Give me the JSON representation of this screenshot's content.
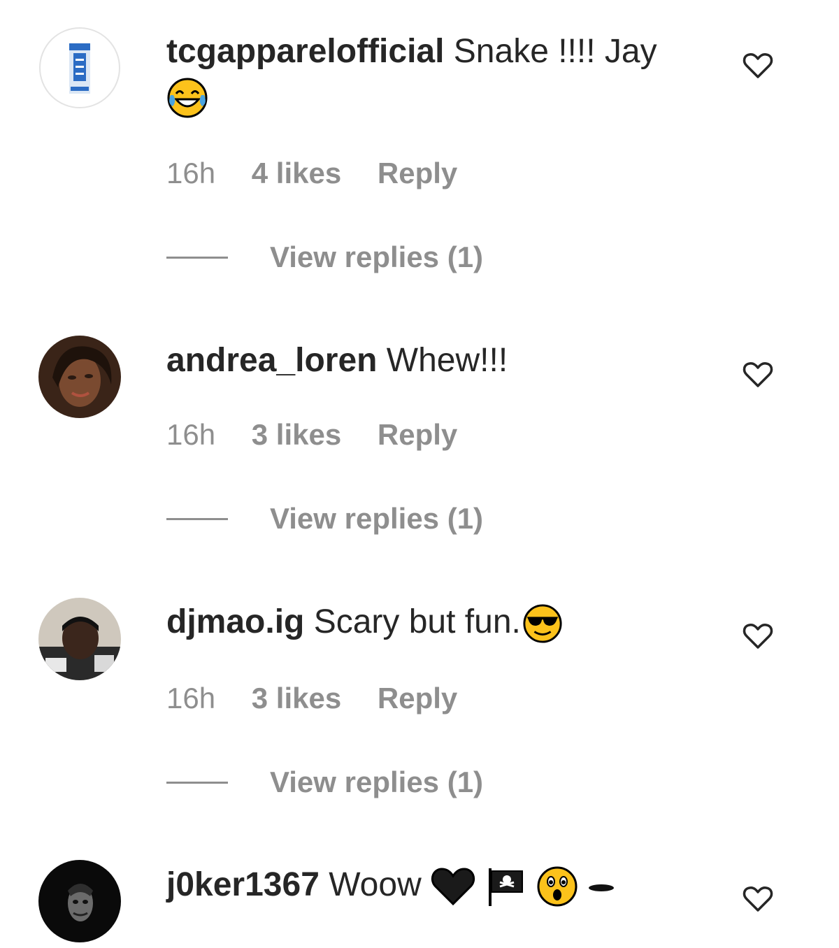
{
  "comments": [
    {
      "username": "tcgapparelofficial",
      "text": "Snake !!!! Jay",
      "emojis": [
        "tears-of-joy-emoji"
      ],
      "time": "16h",
      "likes": "4 likes",
      "reply_label": "Reply",
      "view_replies": "View replies (1)"
    },
    {
      "username": "andrea_loren",
      "text": "Whew!!!",
      "emojis": [],
      "time": "16h",
      "likes": "3 likes",
      "reply_label": "Reply",
      "view_replies": "View replies (1)"
    },
    {
      "username": "djmao.ig",
      "text": "Scary but fun.",
      "emojis": [
        "sunglasses-emoji"
      ],
      "time": "16h",
      "likes": "3 likes",
      "reply_label": "Reply",
      "view_replies": "View replies (1)"
    },
    {
      "username": "j0ker1367",
      "text": "Woow",
      "emojis": [
        "black-heart-emoji",
        "pirate-flag-emoji",
        "astonished-emoji",
        "dash-emoji"
      ]
    }
  ],
  "icons": {
    "like": "heart-outline-icon"
  },
  "colors": {
    "text": "#262626",
    "muted": "#8e8e8e",
    "link": "#8e8e8e"
  }
}
